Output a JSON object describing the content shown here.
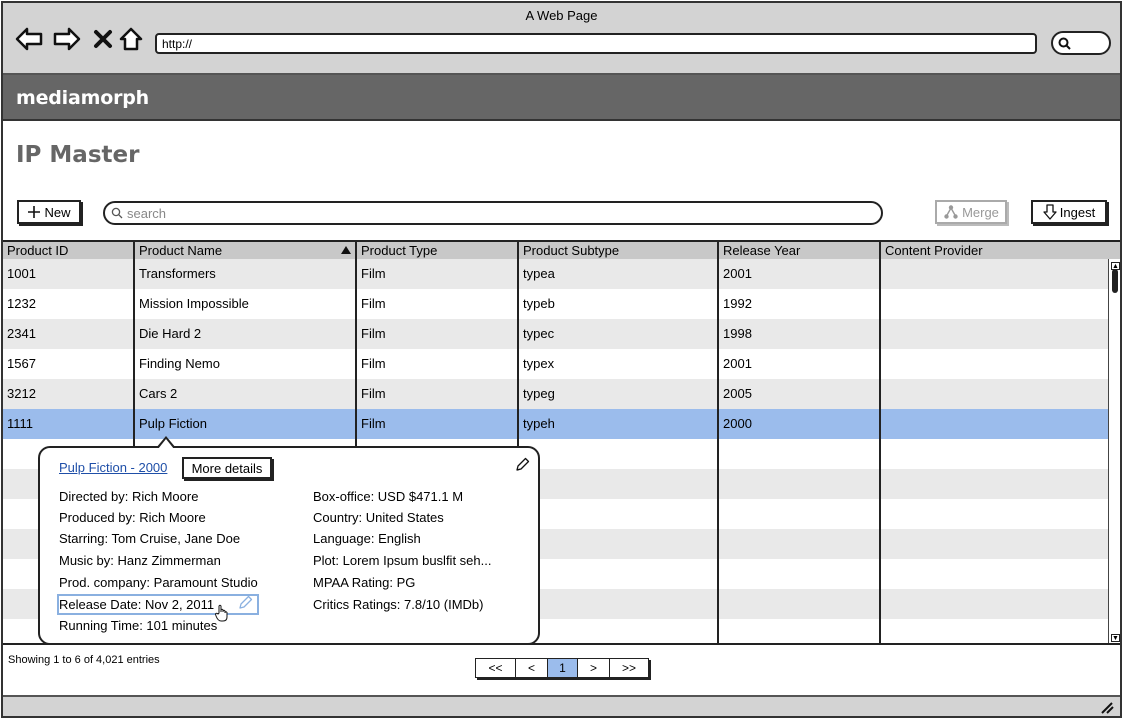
{
  "window": {
    "title": "A Web Page"
  },
  "browser": {
    "url_value": "http://",
    "icons": [
      "back-arrow-icon",
      "forward-arrow-icon",
      "close-x-icon",
      "home-icon",
      "search-icon"
    ]
  },
  "app": {
    "brand": "mediamorph",
    "page_title": "IP Master"
  },
  "toolbar": {
    "new_label": "New",
    "search_placeholder": "search",
    "merge_label": "Merge",
    "ingest_label": "Ingest"
  },
  "table": {
    "columns": [
      "Product ID",
      "Product Name",
      "Product Type",
      "Product Subtype",
      "Release Year",
      "Content Provider"
    ],
    "sorted_column": "Product Name",
    "sort_direction": "ascending",
    "rows": [
      {
        "id": "1001",
        "name": "Transformers",
        "type": "Film",
        "subtype": "typea",
        "year": "2001",
        "provider": ""
      },
      {
        "id": "1232",
        "name": "Mission Impossible",
        "type": "Film",
        "subtype": "typeb",
        "year": "1992",
        "provider": ""
      },
      {
        "id": "2341",
        "name": "Die Hard 2",
        "type": "Film",
        "subtype": "typec",
        "year": "1998",
        "provider": ""
      },
      {
        "id": "1567",
        "name": "Finding Nemo",
        "type": "Film",
        "subtype": "typex",
        "year": "2001",
        "provider": ""
      },
      {
        "id": "3212",
        "name": "Cars 2",
        "type": "Film",
        "subtype": "typeg",
        "year": "2005",
        "provider": ""
      },
      {
        "id": "1111",
        "name": "Pulp Fiction",
        "type": "Film",
        "subtype": "typeh",
        "year": "2000",
        "provider": ""
      }
    ],
    "selected_row": 5
  },
  "popup": {
    "title_link": "Pulp Fiction - 2000",
    "more_details_label": "More details",
    "left_fields": [
      "Directed by: Rich Moore",
      "Produced by: Rich Moore",
      "Starring: Tom Cruise, Jane Doe",
      "Music by: Hanz Zimmerman",
      "Prod. company: Paramount Studio",
      "Release Date: Nov 2, 2011",
      "Running Time: 101 minutes"
    ],
    "right_fields": [
      "Box-office: USD $471.1 M",
      "Country: United States",
      "Language: English",
      "Plot: Lorem Ipsum buslfit seh...",
      "MPAA Rating: PG",
      "Critics Ratings: 7.8/10 (IMDb)"
    ]
  },
  "footer": {
    "info": "Showing 1 to 6 of 4,021 entries",
    "pager": [
      "<<",
      "<",
      "1",
      ">",
      ">>"
    ],
    "current_page": "1"
  },
  "colors": {
    "selected_row": "#9bbcec",
    "appbar": "#666666",
    "link": "#1f4fa8"
  }
}
